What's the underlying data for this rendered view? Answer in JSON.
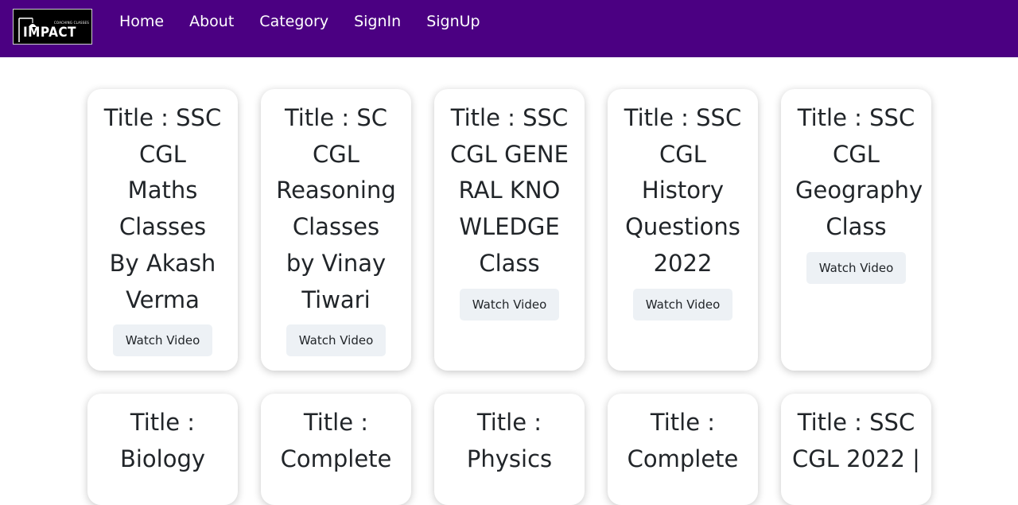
{
  "navbar": {
    "logo": {
      "main_text": "IMPACT",
      "tagline": "COACHING CLASSES"
    },
    "links": [
      "Home",
      "About",
      "Category",
      "SignIn",
      "SignUp"
    ],
    "background": "#4b0082"
  },
  "cards": [
    {
      "title": "Title : SSC CGL Maths Classes By Akash Verma",
      "button": "Watch Video"
    },
    {
      "title": "Title : SC CGL Reasoning Classes by Vinay Tiwari",
      "button": "Watch Video"
    },
    {
      "title": "Title : SSC CGL GENERAL KNOWLEDGE Class",
      "button": "Watch Video"
    },
    {
      "title": "Title : SSC CGL History Questions 2022",
      "button": "Watch Video"
    },
    {
      "title": "Title : SSC CGL Geography Class",
      "button": "Watch Video"
    },
    {
      "title": "Title : Biology",
      "button": ""
    },
    {
      "title": "Title : Complete",
      "button": ""
    },
    {
      "title": "Title : Physics",
      "button": ""
    },
    {
      "title": "Title : Complete",
      "button": ""
    },
    {
      "title": "Title : SSC CGL 2022 |",
      "button": ""
    }
  ]
}
